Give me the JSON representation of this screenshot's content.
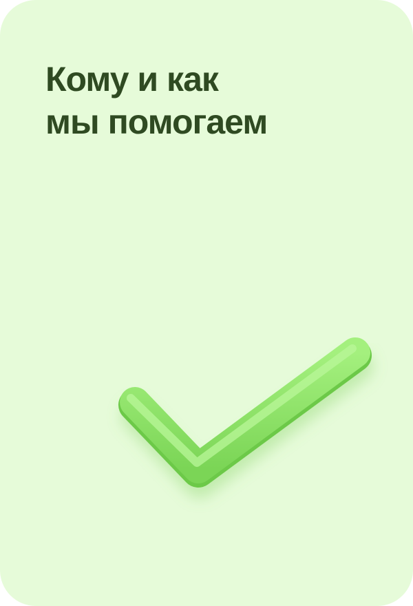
{
  "card": {
    "title_line_1": "Кому и как",
    "title_line_2": "мы помогаем",
    "background_color": "#e6fbd9",
    "text_color": "#2f4a22"
  },
  "illustration": {
    "icon": "checkmark-icon",
    "color": "#8fe268"
  }
}
